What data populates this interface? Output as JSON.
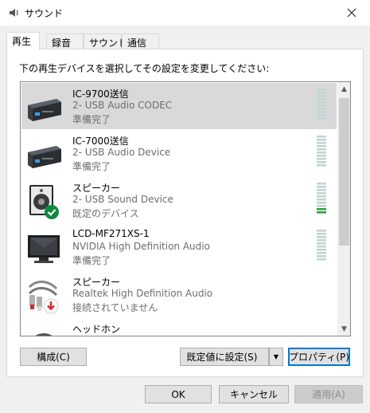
{
  "window": {
    "title": "サウンド",
    "close_icon": "close-icon"
  },
  "tabs": [
    {
      "label": "再生",
      "active": true
    },
    {
      "label": "録音",
      "active": false
    },
    {
      "label": "サウンド",
      "active": false
    },
    {
      "label": "通信",
      "active": false
    }
  ],
  "instruction": "下の再生デバイスを選択してその設定を変更してください:",
  "devices": [
    {
      "name": "IC-9700送信",
      "description": "2- USB Audio CODEC",
      "status": "準備完了",
      "icon": "usb-audio-device-icon",
      "selected": true,
      "meter_level": 0
    },
    {
      "name": "IC-7000送信",
      "description": "2- USB Audio Device",
      "status": "準備完了",
      "icon": "usb-audio-device-icon",
      "selected": false,
      "meter_level": 0
    },
    {
      "name": "スピーカー",
      "description": "2- USB Sound Device",
      "status": "既定のデバイス",
      "icon": "speaker-default-icon",
      "selected": false,
      "meter_level": 0.2
    },
    {
      "name": "LCD-MF271XS-1",
      "description": "NVIDIA High Definition Audio",
      "status": "準備完了",
      "icon": "monitor-icon",
      "selected": false,
      "meter_level": 0
    },
    {
      "name": "スピーカー",
      "description": "Realtek High Definition Audio",
      "status": "接続されていません",
      "icon": "rca-cable-disconnected-icon",
      "selected": false,
      "meter_level": null
    },
    {
      "name": "ヘッドホン",
      "description": "",
      "status": "",
      "icon": "headphones-icon",
      "selected": false,
      "meter_level": null
    }
  ],
  "buttons": {
    "configure": "構成(C)",
    "set_default": "既定値に設定(S)",
    "properties": "プロパティ(P)",
    "ok": "OK",
    "cancel": "キャンセル",
    "apply": "適用(A)"
  },
  "colors": {
    "selection": "#d9d9d9",
    "meter_idle": "#c2d3d4",
    "meter_active": "#2f9e3f",
    "default_check": "#10893e"
  }
}
